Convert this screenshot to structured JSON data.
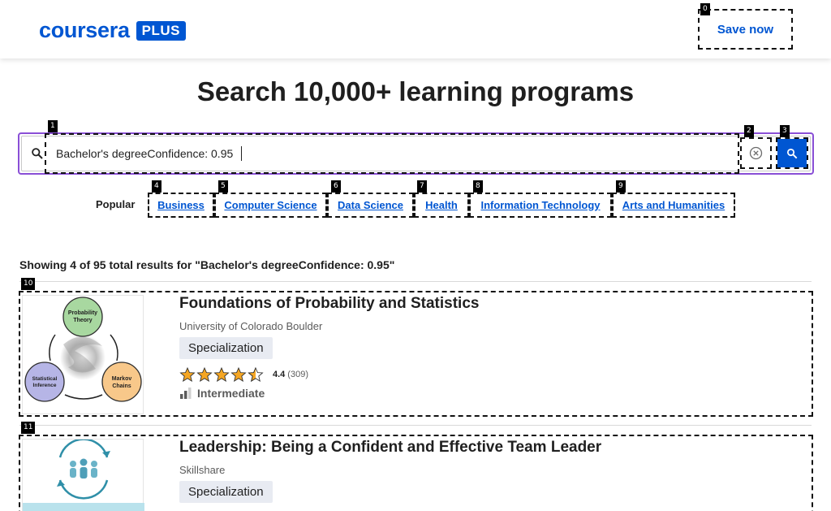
{
  "brand": {
    "name": "coursera",
    "plus_badge": "PLUS",
    "color": "#0056d2"
  },
  "header": {
    "save_label": "Save now"
  },
  "page": {
    "headline": "Search 10,000+ learning programs"
  },
  "search": {
    "value": "Bachelor's degreeConfidence: 0.95",
    "placeholder": ""
  },
  "popular": {
    "label": "Popular",
    "items": [
      {
        "label": "Business"
      },
      {
        "label": "Computer Science"
      },
      {
        "label": "Data Science"
      },
      {
        "label": "Health"
      },
      {
        "label": "Information Technology"
      },
      {
        "label": "Arts and Humanities"
      }
    ]
  },
  "results": {
    "summary": "Showing 4 of 95 total results for \"Bachelor's degreeConfidence: 0.95\"",
    "items": [
      {
        "title": "Foundations of Probability and Statistics",
        "partner": "University of Colorado Boulder",
        "type": "Specialization",
        "rating": "4.4",
        "rating_value": 4.4,
        "reviews": "(309)",
        "level": "Intermediate",
        "thumb_labels": {
          "top": "Probability\nTheory",
          "left": "Statistical\nInference",
          "right": "Markov\nChains"
        }
      },
      {
        "title": "Leadership: Being a Confident and Effective Team Leader",
        "partner": "Skillshare",
        "type": "Specialization"
      }
    ]
  },
  "tags": [
    "0",
    "1",
    "2",
    "3",
    "4",
    "5",
    "6",
    "7",
    "8",
    "9",
    "10",
    "11"
  ]
}
